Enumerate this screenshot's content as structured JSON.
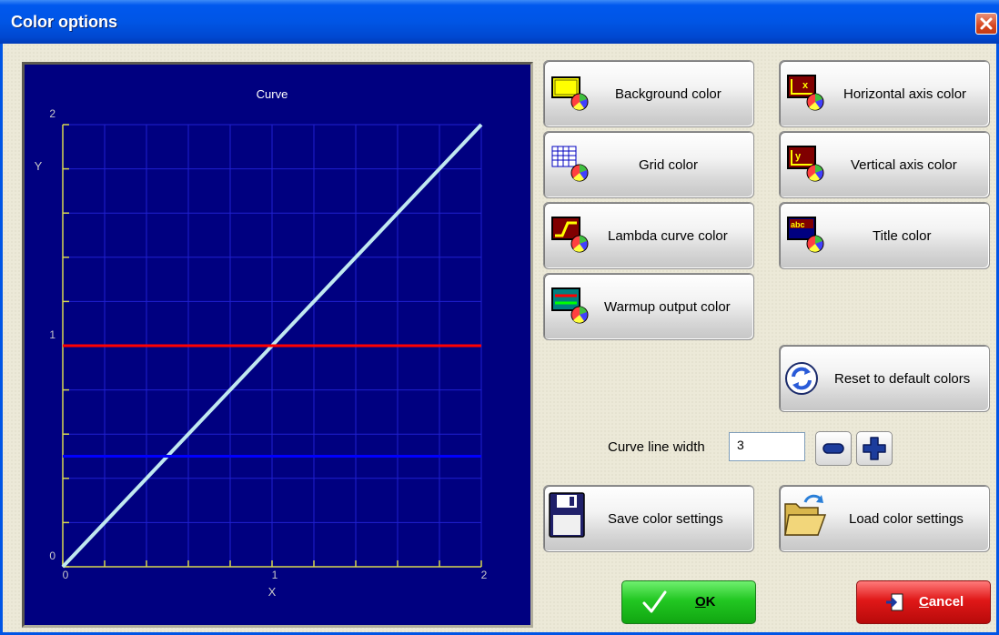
{
  "window": {
    "title": "Color options"
  },
  "plot": {
    "title": "Curve",
    "xlabel": "X",
    "ylabel": "Y",
    "x_ticks": [
      "0",
      "1",
      "2"
    ],
    "y_ticks": [
      "0",
      "1",
      "2"
    ]
  },
  "chart_data": {
    "type": "line",
    "title": "Curve",
    "xlabel": "X",
    "ylabel": "Y",
    "xlim": [
      0,
      2
    ],
    "ylim": [
      0,
      2
    ],
    "grid": true,
    "series": [
      {
        "x": [
          0,
          2
        ],
        "y": [
          0,
          2
        ],
        "color": "#c0e8f0"
      },
      {
        "x": [
          0,
          2
        ],
        "y": [
          1,
          1
        ],
        "color": "#ff0000"
      },
      {
        "x": [
          0,
          2
        ],
        "y": [
          0.5,
          0.5
        ],
        "color": "#0000ff"
      }
    ],
    "colors": {
      "background": "#000080",
      "grid": "#2020d0",
      "axis": "#d8d850"
    }
  },
  "buttons": {
    "background_color": "Background color",
    "grid_color": "Grid color",
    "lambda_curve_color": "Lambda curve color",
    "warmup_output_color": "Warmup output color",
    "horizontal_axis_color": "Horizontal axis color",
    "vertical_axis_color": "Vertical axis color",
    "title_color": "Title color",
    "reset_default_colors": "Reset to default colors",
    "save_color_settings": "Save color settings",
    "load_color_settings": "Load color settings",
    "ok_pre": "",
    "ok_u": "O",
    "ok_post": "K",
    "cancel_u": "C",
    "cancel_post": "ancel"
  },
  "curve_line_width": {
    "label": "Curve line width",
    "value": "3"
  }
}
